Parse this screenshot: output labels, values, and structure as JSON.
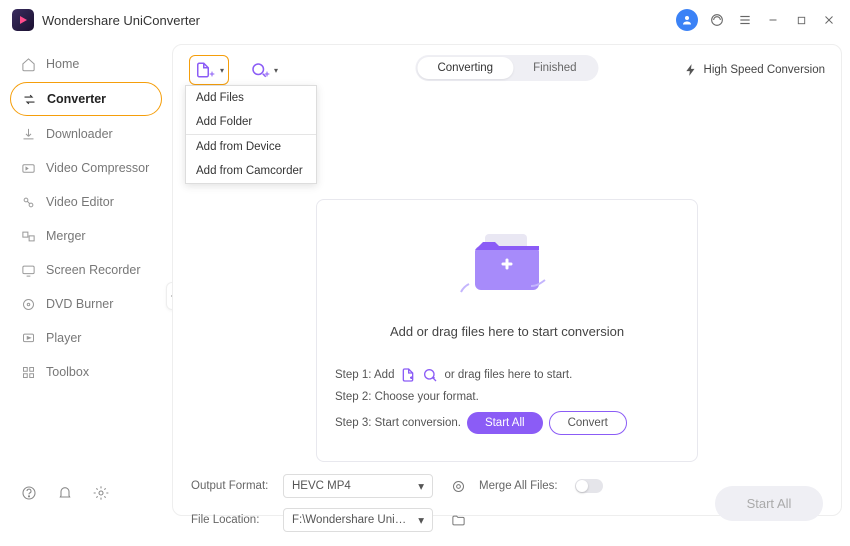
{
  "app": {
    "title": "Wondershare UniConverter"
  },
  "sidebar": {
    "items": [
      {
        "label": "Home",
        "icon": "home"
      },
      {
        "label": "Converter",
        "icon": "converter",
        "active": true
      },
      {
        "label": "Downloader",
        "icon": "downloader"
      },
      {
        "label": "Video Compressor",
        "icon": "compressor"
      },
      {
        "label": "Video Editor",
        "icon": "editor"
      },
      {
        "label": "Merger",
        "icon": "merger"
      },
      {
        "label": "Screen Recorder",
        "icon": "recorder"
      },
      {
        "label": "DVD Burner",
        "icon": "dvd"
      },
      {
        "label": "Player",
        "icon": "player"
      },
      {
        "label": "Toolbox",
        "icon": "toolbox"
      }
    ]
  },
  "tabs": {
    "converting": "Converting",
    "finished": "Finished",
    "active": "converting"
  },
  "hsc_label": "High Speed Conversion",
  "add_menu": {
    "items": [
      "Add Files",
      "Add Folder",
      "Add from Device",
      "Add from Camcorder"
    ]
  },
  "dropzone": {
    "heading": "Add or drag files here to start conversion",
    "step1_prefix": "Step 1: Add",
    "step1_suffix": "or drag files here to start.",
    "step2": "Step 2: Choose your format.",
    "step3": "Step 3: Start conversion.",
    "start_all": "Start All",
    "convert": "Convert"
  },
  "bottom": {
    "out_label": "Output Format:",
    "out_value": "HEVC MP4",
    "merge_label": "Merge All Files:",
    "loc_label": "File Location:",
    "loc_value": "F:\\Wondershare UniConverter",
    "start_all": "Start All"
  }
}
